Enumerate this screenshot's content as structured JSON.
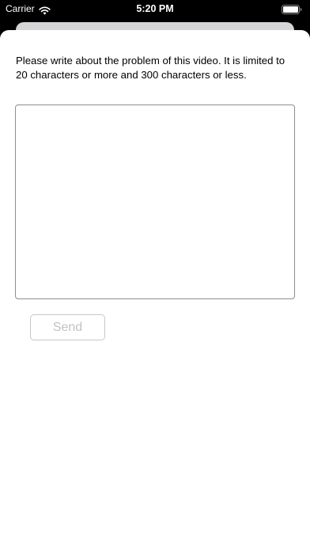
{
  "status_bar": {
    "carrier": "Carrier",
    "time": "5:20 PM",
    "wifi_icon": "wifi-icon",
    "battery_icon": "battery-icon"
  },
  "sheet": {
    "instructions": "Please write about the problem of this video. It is limited to 20 characters or more and 300 characters or less.",
    "textarea": {
      "value": "",
      "placeholder": ""
    },
    "send_label": "Send"
  },
  "colors": {
    "background": "#000000",
    "sheet": "#ffffff",
    "sheet_back": "#d5d5d7",
    "textarea_border": "#8e8e93",
    "send_disabled_text": "#c2c2c7",
    "send_border": "#c7c7cc"
  }
}
